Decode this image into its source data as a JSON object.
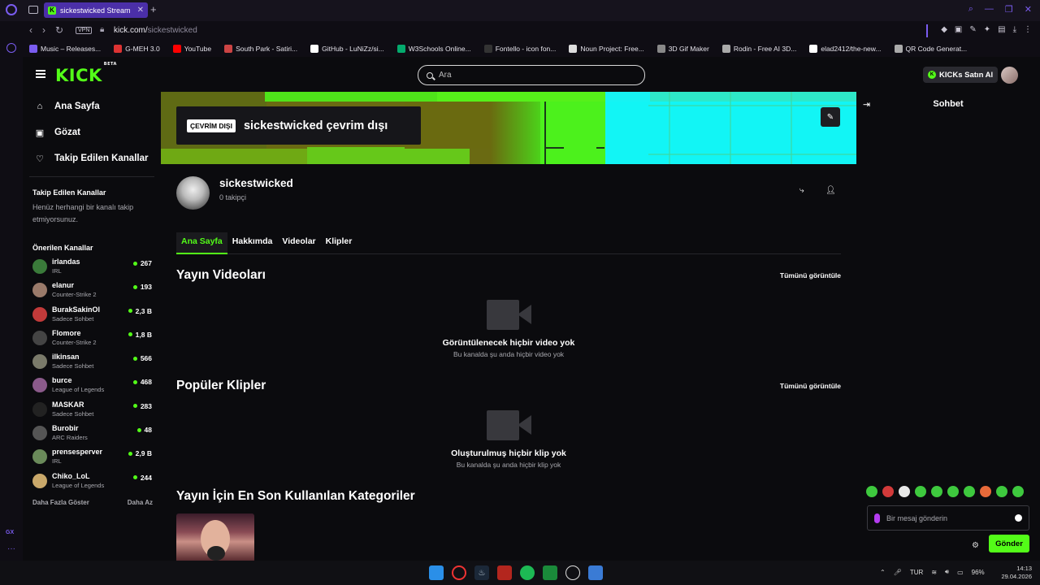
{
  "browser": {
    "tab_title": "sickestwicked Stream",
    "url_host": "kick.com/",
    "url_path": "sickestwicked",
    "vpn_label": "VPN",
    "bookmarks": [
      {
        "label": "Music – Releases...",
        "color": "#7a5cf0"
      },
      {
        "label": "G-MEH 3.0",
        "color": "#d33"
      },
      {
        "label": "YouTube",
        "color": "#f00"
      },
      {
        "label": "South Park - Satiri...",
        "color": "#c44"
      },
      {
        "label": "GitHub - LuNiZz/si...",
        "color": "#fff"
      },
      {
        "label": "W3Schools Online...",
        "color": "#04aa6d"
      },
      {
        "label": "Fontello - icon fon...",
        "color": "#333"
      },
      {
        "label": "Noun Project: Free...",
        "color": "#ddd"
      },
      {
        "label": "3D Gif Maker",
        "color": "#888"
      },
      {
        "label": "Rodin - Free AI 3D...",
        "color": "#aaa"
      },
      {
        "label": "elad2412/the-new...",
        "color": "#fff"
      },
      {
        "label": "QR Code Generat...",
        "color": "#aaa"
      }
    ]
  },
  "header": {
    "logo": "KICK",
    "logo_sup": "BETA",
    "search_placeholder": "Ara",
    "buy_label": "KICKs Satın Al"
  },
  "sidebar": {
    "nav": [
      {
        "label": "Ana Sayfa",
        "icon": "home-icon"
      },
      {
        "label": "Gözat",
        "icon": "browse-icon"
      },
      {
        "label": "Takip Edilen Kanallar",
        "icon": "heart-icon"
      }
    ],
    "followed_title": "Takip Edilen Kanallar",
    "followed_empty": "Henüz herhangi bir kanalı takip etmiyorsunuz.",
    "recommended_title": "Önerilen Kanallar",
    "recommended": [
      {
        "name": "irlandas",
        "category": "IRL",
        "viewers": "267",
        "avatar": "#3a7a3a"
      },
      {
        "name": "elanur",
        "category": "Counter-Strike 2",
        "viewers": "193",
        "avatar": "#9a7a6a"
      },
      {
        "name": "BurakSakinOl",
        "category": "Sadece Sohbet",
        "viewers": "2,3 B",
        "avatar": "#c23a3a"
      },
      {
        "name": "Flomore",
        "category": "Counter-Strike 2",
        "viewers": "1,8 B",
        "avatar": "#444"
      },
      {
        "name": "ilkinsan",
        "category": "Sadece Sohbet",
        "viewers": "566",
        "avatar": "#7a7a6a"
      },
      {
        "name": "burce",
        "category": "League of Legends",
        "viewers": "468",
        "avatar": "#8a5a8a"
      },
      {
        "name": "MASKAR",
        "category": "Sadece Sohbet",
        "viewers": "283",
        "avatar": "#222"
      },
      {
        "name": "Burobir",
        "category": "ARC Raiders",
        "viewers": "48",
        "avatar": "#555"
      },
      {
        "name": "prensesperver",
        "category": "IRL",
        "viewers": "2,9 B",
        "avatar": "#6a8a5a"
      },
      {
        "name": "Chiko_LoL",
        "category": "League of Legends",
        "viewers": "244",
        "avatar": "#c9a86a"
      }
    ],
    "show_more": "Daha Fazla Göster",
    "show_less": "Daha Az"
  },
  "channel": {
    "offline_badge": "ÇEVRİM DIŞI",
    "offline_title": "sickestwicked çevrim dışı",
    "name": "sickestwicked",
    "followers": "0 takipçi",
    "tabs": [
      "Ana Sayfa",
      "Hakkımda",
      "Videolar",
      "Klipler"
    ],
    "videos_title": "Yayın Videoları",
    "videos_see_all": "Tümünü görüntüle",
    "videos_empty_title": "Görüntülenecek hiçbir video yok",
    "videos_empty_sub": "Bu kanalda şu anda hiçbir video yok",
    "clips_title": "Popüler Klipler",
    "clips_see_all": "Tümünü görüntüle",
    "clips_empty_title": "Oluşturulmuş hiçbir klip yok",
    "clips_empty_sub": "Bu kanalda şu anda hiçbir klip yok",
    "categories_title": "Yayın İçin En Son Kullanılan Kategoriler"
  },
  "chat": {
    "title": "Sohbet",
    "placeholder": "Bir mesaj gönderin",
    "send_label": "Gönder",
    "emote_colors": [
      "#3ec93e",
      "#d23a3a",
      "#e8e8e8",
      "#3ec93e",
      "#3ec93e",
      "#3ec93e",
      "#3ec93e",
      "#e86a3a",
      "#3ec93e",
      "#3ec93e"
    ]
  },
  "taskbar": {
    "language": "TUR",
    "battery": "96%",
    "time": "14:13",
    "date": "29.04.2026"
  },
  "colors": {
    "accent": "#53fc18",
    "browser_accent": "#7a5cf0"
  }
}
